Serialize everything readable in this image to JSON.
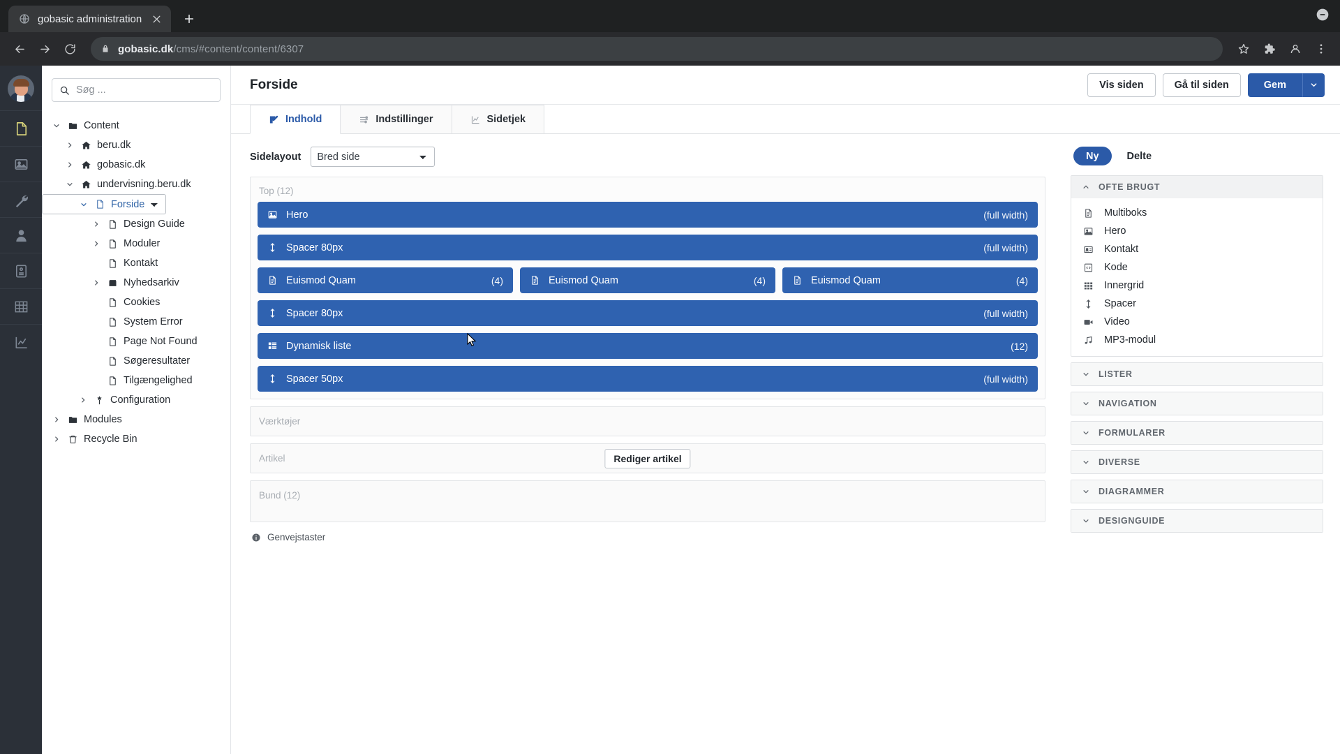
{
  "browser": {
    "tab_title": "gobasic administration",
    "url_host": "gobasic.dk",
    "url_path": "/cms/#content/content/6307",
    "new_tab_label": "+"
  },
  "rail": {
    "items": [
      {
        "name": "content",
        "icon": "document-icon",
        "active": true
      },
      {
        "name": "media",
        "icon": "image-icon",
        "active": false
      },
      {
        "name": "settings",
        "icon": "wrench-icon",
        "active": false
      },
      {
        "name": "users",
        "icon": "user-icon",
        "active": false
      },
      {
        "name": "forms",
        "icon": "form-icon",
        "active": false
      },
      {
        "name": "tables",
        "icon": "grid-icon",
        "active": false
      },
      {
        "name": "analytics",
        "icon": "chart-icon",
        "active": false
      }
    ]
  },
  "sidebar": {
    "search_placeholder": "Søg ...",
    "tree": [
      {
        "label": "Content",
        "depth": 0,
        "caret": "down",
        "icon": "folder-icon",
        "selected": false
      },
      {
        "label": "beru.dk",
        "depth": 1,
        "caret": "right",
        "icon": "home-icon",
        "selected": false
      },
      {
        "label": "gobasic.dk",
        "depth": 1,
        "caret": "right",
        "icon": "home-icon",
        "selected": false
      },
      {
        "label": "undervisning.beru.dk",
        "depth": 1,
        "caret": "down",
        "icon": "home-icon",
        "selected": false
      },
      {
        "label": "Forside",
        "depth": 2,
        "caret": "down",
        "icon": "page-icon",
        "selected": true
      },
      {
        "label": "Design Guide",
        "depth": 3,
        "caret": "right",
        "icon": "page-icon",
        "selected": false
      },
      {
        "label": "Moduler",
        "depth": 3,
        "caret": "right",
        "icon": "page-icon",
        "selected": false
      },
      {
        "label": "Kontakt",
        "depth": 3,
        "caret": "none",
        "icon": "page-icon",
        "selected": false
      },
      {
        "label": "Nyhedsarkiv",
        "depth": 3,
        "caret": "right",
        "icon": "archive-icon",
        "selected": false
      },
      {
        "label": "Cookies",
        "depth": 3,
        "caret": "none",
        "icon": "page-icon",
        "selected": false
      },
      {
        "label": "System Error",
        "depth": 3,
        "caret": "none",
        "icon": "page-icon",
        "selected": false
      },
      {
        "label": "Page Not Found",
        "depth": 3,
        "caret": "none",
        "icon": "page-icon",
        "selected": false
      },
      {
        "label": "Søgeresultater",
        "depth": 3,
        "caret": "none",
        "icon": "page-icon",
        "selected": false
      },
      {
        "label": "Tilgængelighed",
        "depth": 3,
        "caret": "none",
        "icon": "page-icon",
        "selected": false
      },
      {
        "label": "Configuration",
        "depth": 2,
        "caret": "right",
        "icon": "config-icon",
        "selected": false
      },
      {
        "label": "Modules",
        "depth": 0,
        "caret": "right",
        "icon": "folder-icon",
        "selected": false
      },
      {
        "label": "Recycle Bin",
        "depth": 0,
        "caret": "right",
        "icon": "trash-icon",
        "selected": false
      }
    ]
  },
  "header": {
    "title": "Forside",
    "view_page_label": "Vis siden",
    "goto_page_label": "Gå til siden",
    "save_label": "Gem"
  },
  "tabs": [
    {
      "label": "Indhold",
      "icon": "edit-icon",
      "active": true
    },
    {
      "label": "Indstillinger",
      "icon": "sliders-icon",
      "active": false
    },
    {
      "label": "Sidetjek",
      "icon": "linechart-icon",
      "active": false
    }
  ],
  "editor": {
    "layout_label": "Sidelayout",
    "layout_value": "Bred side",
    "layout_options": [
      "Bred side"
    ],
    "zones": [
      {
        "name": "top",
        "label": "Top (12)",
        "rows": [
          {
            "type": "single",
            "modules": [
              {
                "name": "Hero",
                "icon": "image-icon",
                "meta": "(full width)"
              }
            ]
          },
          {
            "type": "single",
            "modules": [
              {
                "name": "Spacer 80px",
                "icon": "spacer-icon",
                "meta": "(full width)"
              }
            ]
          },
          {
            "type": "triple",
            "modules": [
              {
                "name": "Euismod Quam",
                "icon": "document-icon",
                "meta": "(4)"
              },
              {
                "name": "Euismod Quam",
                "icon": "document-icon",
                "meta": "(4)"
              },
              {
                "name": "Euismod Quam",
                "icon": "document-icon",
                "meta": "(4)"
              }
            ]
          },
          {
            "type": "single",
            "modules": [
              {
                "name": "Spacer 80px",
                "icon": "spacer-icon",
                "meta": "(full width)"
              }
            ]
          },
          {
            "type": "single",
            "modules": [
              {
                "name": "Dynamisk liste",
                "icon": "list-icon",
                "meta": "(12)"
              }
            ]
          },
          {
            "type": "single",
            "modules": [
              {
                "name": "Spacer 50px",
                "icon": "spacer-icon",
                "meta": "(full width)"
              }
            ]
          }
        ]
      }
    ],
    "tools_zone_label": "Værktøjer",
    "article_zone_label": "Artikel",
    "article_button_label": "Rediger artikel",
    "bottom_zone_label": "Bund (12)",
    "shortcuts_label": "Genvejstaster"
  },
  "right_panel": {
    "new_label": "Ny",
    "shared_label": "Delte",
    "groups": [
      {
        "title": "OFTE BRUGT",
        "expanded": true,
        "items": [
          {
            "label": "Multiboks",
            "icon": "document-icon"
          },
          {
            "label": "Hero",
            "icon": "image-icon"
          },
          {
            "label": "Kontakt",
            "icon": "contact-icon"
          },
          {
            "label": "Kode",
            "icon": "code-icon"
          },
          {
            "label": "Innergrid",
            "icon": "grid-icon"
          },
          {
            "label": "Spacer",
            "icon": "spacer-icon"
          },
          {
            "label": "Video",
            "icon": "video-icon"
          },
          {
            "label": "MP3-modul",
            "icon": "music-icon"
          }
        ]
      },
      {
        "title": "LISTER",
        "expanded": false,
        "items": []
      },
      {
        "title": "NAVIGATION",
        "expanded": false,
        "items": []
      },
      {
        "title": "FORMULARER",
        "expanded": false,
        "items": []
      },
      {
        "title": "DIVERSE",
        "expanded": false,
        "items": []
      },
      {
        "title": "DIAGRAMMER",
        "expanded": false,
        "items": []
      },
      {
        "title": "DESIGNGUIDE",
        "expanded": false,
        "items": []
      }
    ]
  },
  "colors": {
    "primary": "#2b5aa8",
    "module_blue": "#2f62b0",
    "rail_bg": "#2b3038",
    "accent_text": "#3366a8"
  }
}
